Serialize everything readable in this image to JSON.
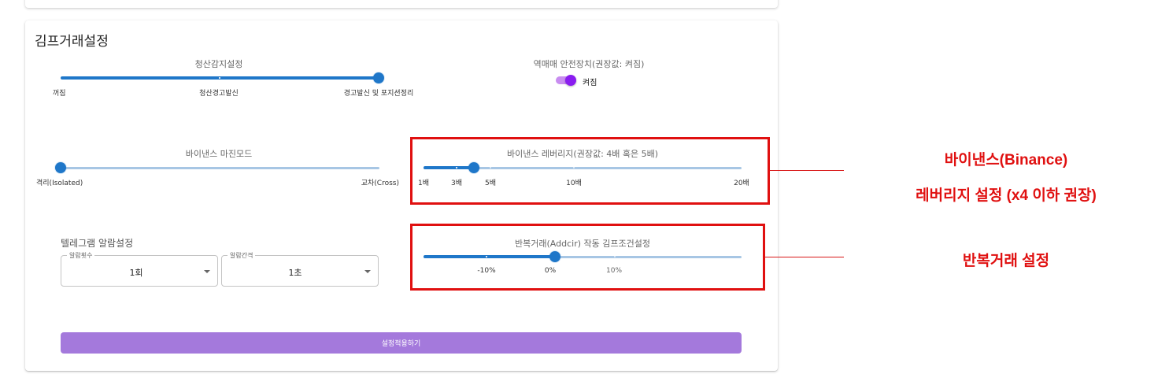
{
  "section_title": "김프거래설정",
  "liquidation": {
    "title": "청산감지설정",
    "labels": [
      "꺼짐",
      "청산경고발신",
      "경고발신 및 포지션정리"
    ],
    "selected": "경고발신 및 포지션정리"
  },
  "reverse_guard": {
    "title": "역매매 안전장치(권장값: 켜짐)",
    "state_label": "켜짐",
    "on": true
  },
  "margin_mode": {
    "title": "바이낸스 마진모드",
    "left_label": "격리(Isolated)",
    "right_label": "교차(Cross)",
    "selected": "격리(Isolated)"
  },
  "leverage": {
    "title": "바이낸스 레버리지(권장값: 4배 혹은 5배)",
    "ticks": [
      "1배",
      "3배",
      "5배",
      "10배",
      "20배"
    ],
    "value": 4,
    "min": 1,
    "max": 20
  },
  "telegram": {
    "title": "텔레그램 알람설정",
    "count": {
      "legend": "알람횟수",
      "value": "1회"
    },
    "interval": {
      "legend": "알람간격",
      "value": "1초"
    }
  },
  "repeat_trade": {
    "title": "반복거래(Addcir) 작동 김프조건설정",
    "ticks": [
      "-10%",
      "0%",
      "10%"
    ],
    "value_percent": 0
  },
  "apply_button": "설정적용하기",
  "annotations": {
    "leverage_line1": "바이낸스(Binance)",
    "leverage_line2": "레버리지 설정 (x4 이하 권장)",
    "repeat": "반복거래 설정"
  },
  "colors": {
    "slider": "#1f77c9",
    "toggle": "#8a1df0",
    "button": "#a479dc",
    "annotation": "#e01010"
  }
}
